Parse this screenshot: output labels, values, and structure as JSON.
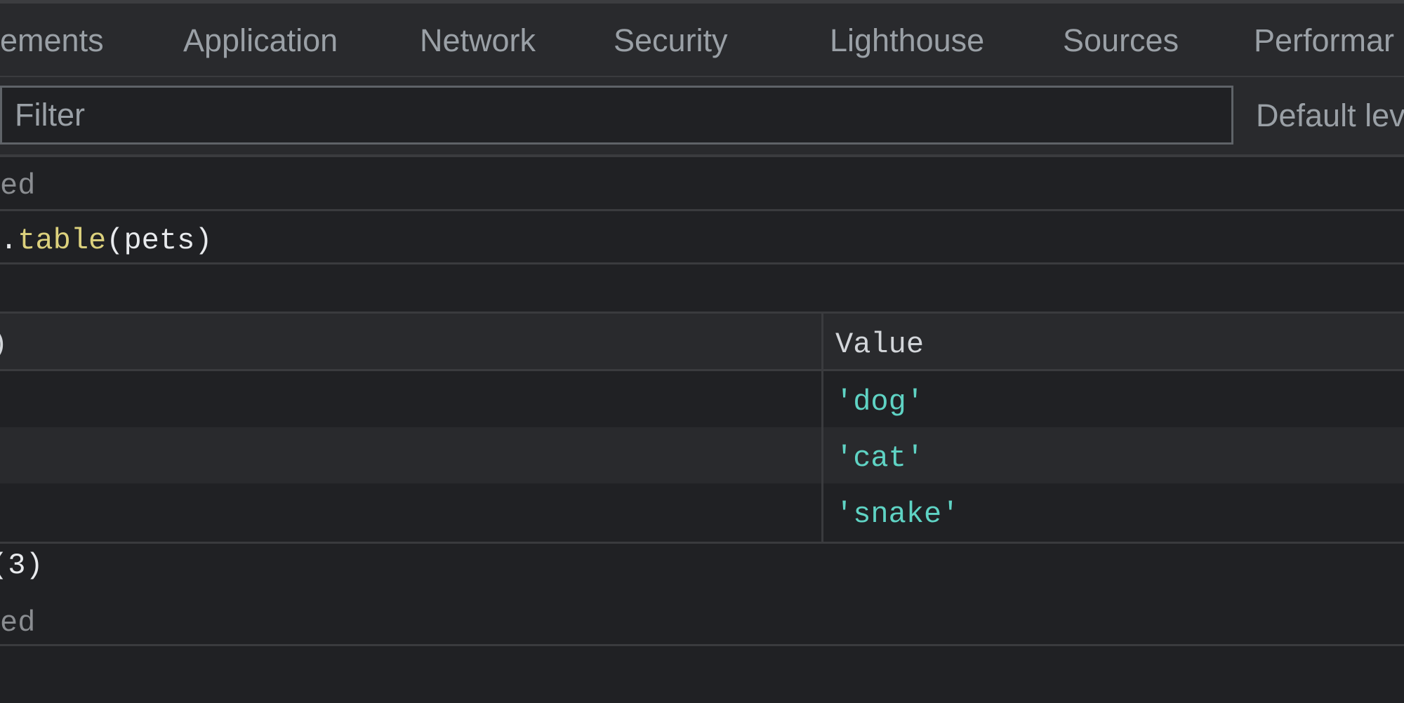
{
  "tabs": [
    {
      "label": "lements"
    },
    {
      "label": "Application"
    },
    {
      "label": "Network"
    },
    {
      "label": "Security"
    },
    {
      "label": "Lighthouse"
    },
    {
      "label": "Sources"
    },
    {
      "label": "Performar"
    }
  ],
  "toolbar": {
    "filter_placeholder": "Filter",
    "levels_label": "Default lev"
  },
  "console": {
    "undefined_1": "ed",
    "command": {
      "prefix": ".",
      "method": "table",
      "open": "(",
      "arg": "pets",
      "close": ")"
    },
    "table": {
      "headers": {
        "index": ")",
        "value": "Value"
      },
      "rows": [
        {
          "value": "'dog'"
        },
        {
          "value": "'cat'"
        },
        {
          "value": "'snake'"
        }
      ]
    },
    "summary": "(3)",
    "undefined_2": "ed"
  },
  "colors": {
    "background": "#202124",
    "panel": "#292a2d",
    "muted_text": "#9aa0a6",
    "string": "#5fd3c4",
    "method": "#dcd17d"
  }
}
